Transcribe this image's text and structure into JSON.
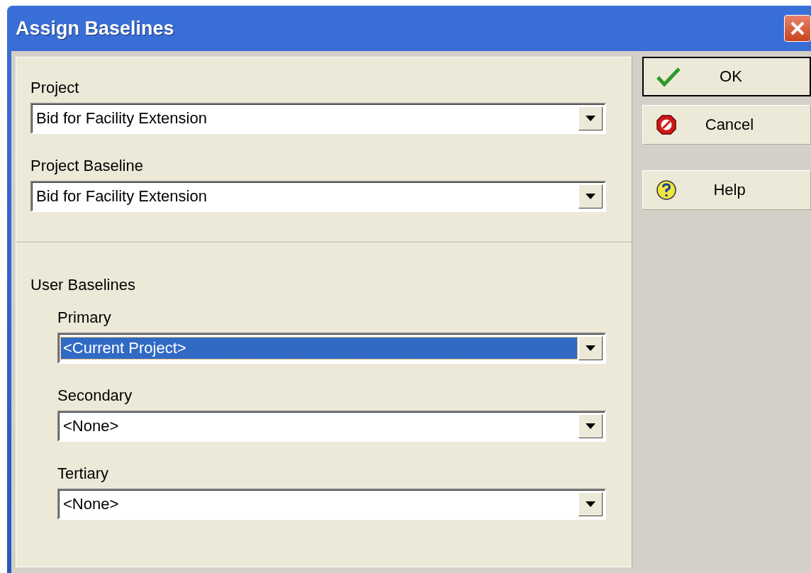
{
  "window": {
    "title": "Assign Baselines"
  },
  "project_section": {
    "fields": [
      {
        "label": "Project",
        "value": "Bid for Facility Extension",
        "focused": false
      },
      {
        "label": "Project Baseline",
        "value": "Bid for Facility Extension",
        "focused": false
      }
    ]
  },
  "user_baselines": {
    "heading": "User Baselines",
    "fields": [
      {
        "label": "Primary",
        "value": "<Current Project>",
        "focused": true
      },
      {
        "label": "Secondary",
        "value": "<None>",
        "focused": false
      },
      {
        "label": "Tertiary",
        "value": "<None>",
        "focused": false
      }
    ]
  },
  "buttons": [
    {
      "label": "OK",
      "kind": "ok",
      "default": true
    },
    {
      "label": "Cancel",
      "kind": "cancel",
      "default": false
    },
    {
      "label": "Help",
      "kind": "help",
      "default": false
    }
  ]
}
